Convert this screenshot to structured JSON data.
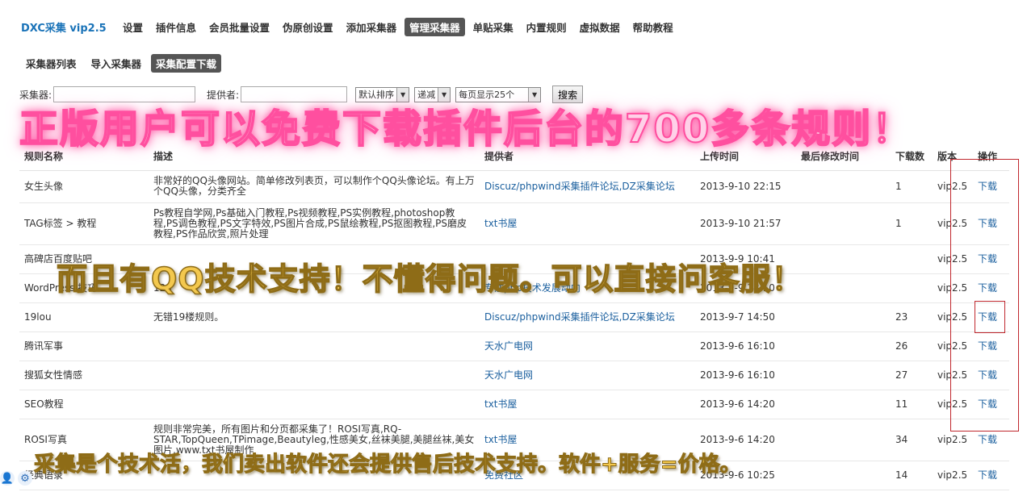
{
  "brand": "DXC采集 vip2.5",
  "topnav": [
    "设置",
    "插件信息",
    "会员批量设置",
    "伪原创设置",
    "添加采集器",
    "管理采集器",
    "单贴采集",
    "内置规则",
    "虚拟数据",
    "帮助教程"
  ],
  "subnav": [
    "采集器列表",
    "导入采集器",
    "采集配置下载"
  ],
  "filters": {
    "collector_label": "采集器:",
    "provider_label": "提供者:",
    "sort_value": "默认排序",
    "order_value": "递减",
    "perpage_value": "每页显示25个",
    "search_button": "搜索"
  },
  "table": {
    "headers": [
      "规则名称",
      "描述",
      "提供者",
      "上传时间",
      "最后修改时间",
      "下载数",
      "版本",
      "操作"
    ],
    "rows": [
      {
        "name": "女生头像",
        "desc": "非常好的QQ头像网站。简单修改列表页，可以制作个QQ头像论坛。有上万个QQ头像，分类齐全",
        "provider": "Discuz/phpwind采集插件论坛,DZ采集论坛",
        "uploaded": "2013-9-10 22:15",
        "modified": "",
        "downloads": "1",
        "version": "vip2.5",
        "action": "下载"
      },
      {
        "name": "TAG标签 > 教程",
        "desc": "Ps教程自学网,Ps基础入门教程,Ps视频教程,PS实例教程,photoshop教程,PS调色教程,PS文字特效,PS图片合成,PS鼠绘教程,PS抠图教程,PS磨皮教程,PS作品欣赏,照片处理",
        "provider": "txt书屋",
        "uploaded": "2013-9-10 21:57",
        "modified": "",
        "downloads": "1",
        "version": "vip2.5",
        "action": "下载"
      },
      {
        "name": "高碑店百度贴吧",
        "desc": "",
        "provider": "",
        "uploaded": "2013-9-9 10:41",
        "modified": "",
        "downloads": "",
        "version": "vip2.5",
        "action": "下载"
      },
      {
        "name": "WordPress 技巧",
        "desc": "123",
        "provider": "专注php技术发展动向",
        "uploaded": "2013-9-9 18:10",
        "modified": "",
        "downloads": "",
        "version": "vip2.5",
        "action": "下载"
      },
      {
        "name": "19lou",
        "desc": "无错19楼规则。",
        "provider": "Discuz/phpwind采集插件论坛,DZ采集论坛",
        "uploaded": "2013-9-7 14:50",
        "modified": "",
        "downloads": "23",
        "version": "vip2.5",
        "action": "下载"
      },
      {
        "name": "腾讯军事",
        "desc": "",
        "provider": "天水广电网",
        "uploaded": "2013-9-6 16:10",
        "modified": "",
        "downloads": "26",
        "version": "vip2.5",
        "action": "下载"
      },
      {
        "name": "搜狐女性情感",
        "desc": "",
        "provider": "天水广电网",
        "uploaded": "2013-9-6 16:10",
        "modified": "",
        "downloads": "27",
        "version": "vip2.5",
        "action": "下载"
      },
      {
        "name": "SEO教程",
        "desc": "",
        "provider": "txt书屋",
        "uploaded": "2013-9-6 14:20",
        "modified": "",
        "downloads": "11",
        "version": "vip2.5",
        "action": "下载"
      },
      {
        "name": "ROSI写真",
        "desc": "规则非常完美，所有图片和分页都采集了！ROSI写真,RQ-STAR,TopQueen,TPimage,Beautyleg,性感美女,丝袜美腿,美腿丝袜,美女图片,www.txt书屋制作",
        "provider": "txt书屋",
        "uploaded": "2013-9-6 14:20",
        "modified": "",
        "downloads": "34",
        "version": "vip2.5",
        "action": "下载"
      },
      {
        "name": "经典语录",
        "desc": "",
        "provider": "免费社区",
        "uploaded": "2013-9-6 10:25",
        "modified": "",
        "downloads": "14",
        "version": "vip2.5",
        "action": "下载"
      }
    ]
  },
  "overlays": {
    "banner_top": "正版用户可以免费下载插件后台的700多条规则！",
    "banner_mid": "而且有QQ技术支持！不懂得问题。可以直接问客服！",
    "banner_bottom": "采集是个技术活，我们卖出软件还会提供售后技术支持。软件+服务=价格。"
  },
  "icons": {
    "corner": [
      "person-icon",
      "gear-icon"
    ]
  },
  "colors": {
    "link": "#1a5f9e",
    "active_tab": "#555555",
    "highlight_box": "#c0282e"
  }
}
